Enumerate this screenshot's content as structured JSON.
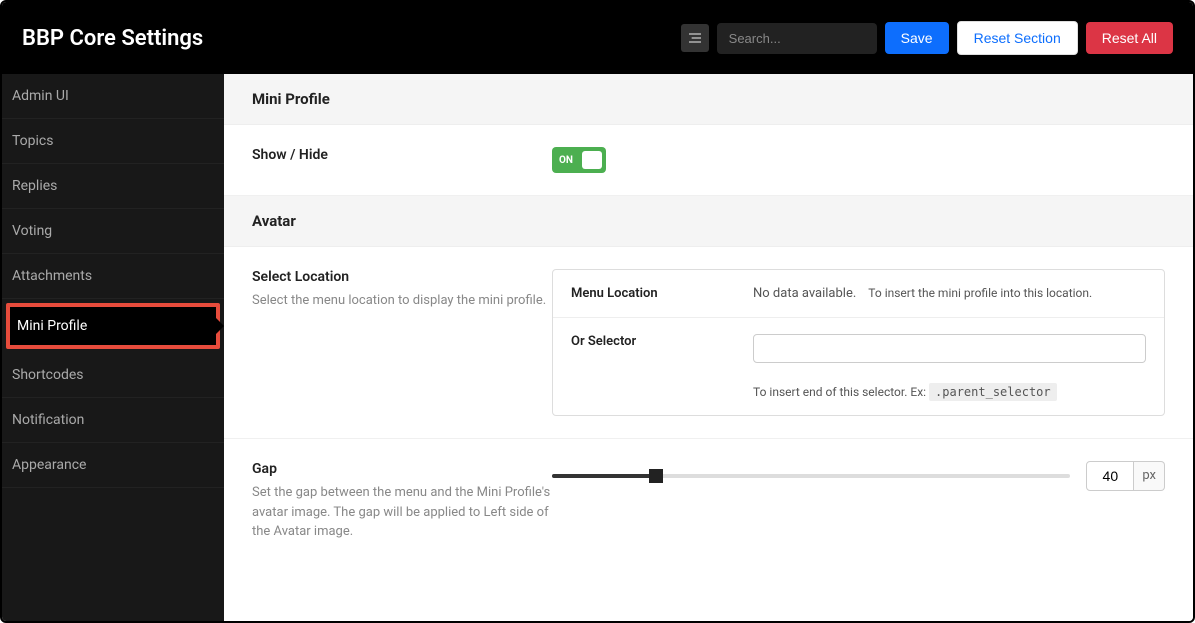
{
  "header": {
    "title": "BBP Core Settings",
    "search_placeholder": "Search...",
    "save_label": "Save",
    "reset_section_label": "Reset Section",
    "reset_all_label": "Reset All"
  },
  "sidebar": {
    "items": [
      {
        "label": "Admin UI"
      },
      {
        "label": "Topics"
      },
      {
        "label": "Replies"
      },
      {
        "label": "Voting"
      },
      {
        "label": "Attachments"
      },
      {
        "label": "Mini Profile"
      },
      {
        "label": "Shortcodes"
      },
      {
        "label": "Notification"
      },
      {
        "label": "Appearance"
      }
    ],
    "active_index": 5
  },
  "sections": {
    "mini_profile": {
      "heading": "Mini Profile",
      "show_hide": {
        "label": "Show / Hide",
        "state_text": "ON",
        "value": true
      }
    },
    "avatar": {
      "heading": "Avatar",
      "select_location": {
        "label": "Select Location",
        "desc": "Select the menu location to display the mini profile.",
        "menu_location_label": "Menu Location",
        "menu_location_nodata": "No data available.",
        "menu_location_hint": "To insert the mini profile into this location.",
        "or_selector_label": "Or Selector",
        "or_selector_value": "",
        "or_selector_hint_prefix": "To insert end of this selector. Ex: ",
        "or_selector_hint_code": ".parent_selector"
      },
      "gap": {
        "label": "Gap",
        "desc": "Set the gap between the menu and the Mini Profile's avatar image. The gap will be applied to Left side of the Avatar image.",
        "value": "40",
        "unit": "px",
        "percent": 20
      }
    }
  }
}
